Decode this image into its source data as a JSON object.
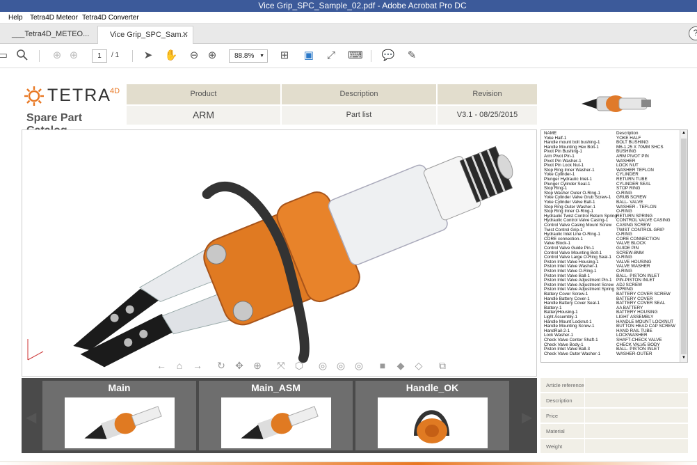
{
  "window": {
    "title": "Vice Grip_SPC_Sample_02.pdf - Adobe Acrobat Pro DC"
  },
  "menu": [
    "Help",
    "Tetra4D Meteor",
    "Tetra4D Converter"
  ],
  "tabs": [
    {
      "label": "___Tetra4D_METEO..."
    },
    {
      "label": "Vice Grip_SPC_Sam..."
    }
  ],
  "toolbar": {
    "page": "1",
    "page_total": "/ 1",
    "zoom": "88.8%"
  },
  "logo": {
    "text": "TETRA",
    "sup": "4D",
    "subtitle": "Spare Part Catalog"
  },
  "header_table": {
    "headers": [
      "Product",
      "Description",
      "Revision"
    ],
    "values": [
      "ARM",
      "Part list",
      "V3.1 - 08/25/2015"
    ]
  },
  "parts": {
    "header": {
      "name": "NAME",
      "desc": "Description"
    },
    "rows": [
      [
        "Yoke Half-1",
        "YOKE HALF"
      ],
      [
        "Handle mount bolt bushing-1",
        "BOLT BUSHING"
      ],
      [
        "Handle Mounting Hex Bolt-1",
        "M6-1.25 X 70MM SHCS"
      ],
      [
        "Pivot Pin Bushing-1",
        "BUSHING"
      ],
      [
        "Arm Pivot Pin-1",
        "ARM PIVOT PIN"
      ],
      [
        "Pivot Pin Washer-1",
        "WASHER"
      ],
      [
        "Pivot Pin Lock Nut-1",
        "LOCK NUT"
      ],
      [
        "Stop Ring Inner Washer-1",
        "WASHER TEFLON"
      ],
      [
        "Yoke Cylinder-1",
        "CYLINDER"
      ],
      [
        "Plunger Hydraulic Inlet-1",
        "RETURN TUBE"
      ],
      [
        "Plunger Cylinder Seal-1",
        "CYLINDER SEAL"
      ],
      [
        "Stop Ring-1",
        "STOP RING"
      ],
      [
        "Stop Washer Outer O-Ring-1",
        "O-RING"
      ],
      [
        "Yoke Cylinder Valve Grub Screw-1",
        "GRUB SCREW"
      ],
      [
        "Yoke Cylinder Valve Ball-1",
        "BALL- VALVE"
      ],
      [
        "Stop Ring Outer Washer-1",
        "WASHER - TEFLON"
      ],
      [
        "Stop Ring Inner O-Ring-1",
        "O-RING"
      ],
      [
        "Hydraulic Twist Control Return Spring",
        "RETURN SPRING"
      ],
      [
        "Hydraulic Control Valve Casing-1",
        "CONTROL VALVE CASING"
      ],
      [
        "Control Valve Casing Mount Screw",
        "CASING SCREW"
      ],
      [
        "Twist Control Grip-1",
        "TWIST CONTROL GRIP"
      ],
      [
        "Hydraulic Inlet Line O-Ring-1",
        "O-RING"
      ],
      [
        "CORE connection-1",
        "CORE CONNECTION"
      ],
      [
        "Valve Block-1",
        "VALVE BLOCK"
      ],
      [
        "Control Valve Guide Pin-1",
        "GUIDE PIN"
      ],
      [
        "Control Valve Mounting Bolt-1",
        "SCREW-8MM"
      ],
      [
        "Control Valve Large O-Ring Seal-1",
        "O-RING"
      ],
      [
        "Piston Inlet Valve Housing-1",
        "VALVE HOUSING"
      ],
      [
        "Piston Inlet Valve Washer-1",
        "VALVE WASHER"
      ],
      [
        "Piston Inlet Valve O-Ring-1",
        "O-RING"
      ],
      [
        "Piston Inlet Valve Ball-1",
        "BALL- PISTON INLET"
      ],
      [
        "Piston Inlet Valve Adjustment Pin-1",
        "PIN-PISTON INLET"
      ],
      [
        "Piston Inlet Valve Adjustment Screw",
        "ADJ SCREW"
      ],
      [
        "Piston Inlet Valve Adjustment Spring",
        "SPRING"
      ],
      [
        "Battery Cover Screw-1",
        "BATTERY COVER SCREW"
      ],
      [
        "Handle Battery Cover-1",
        "BATTERY COVER"
      ],
      [
        "Handle Battery Cover Seal-1",
        "BATTERY COVER SEAL"
      ],
      [
        "Battery-1",
        "AA BATTERY"
      ],
      [
        "BatteryHousing-1",
        "BATTERY HOUSING"
      ],
      [
        "Light Assembly-1",
        "LIGHT ASSEMBLY"
      ],
      [
        "Handle Mount Locknut-1",
        "HANDLE MOUNT LOCKNUT"
      ],
      [
        "Handle Mounting Screw-1",
        "BUTTON HEAD CAP SCREW"
      ],
      [
        "HandRail-2-1",
        "HAND RAIL TUBE"
      ],
      [
        "Lock Washer-1",
        "LOCKWASHER"
      ],
      [
        "Check Valve Center Shaft-1",
        "SHAFT-CHECK VALVE"
      ],
      [
        "Check Valve Body-1",
        "CHECK VALVE BODY"
      ],
      [
        "Piston Inlet Valve Ball-3",
        "BALL- PISTON INLET"
      ],
      [
        "Check Valve Outer Washer-1",
        "WASHER-OUTER"
      ]
    ]
  },
  "thumbnails": [
    {
      "label": "Main"
    },
    {
      "label": "Main_ASM"
    },
    {
      "label": "Handle_OK"
    }
  ],
  "properties": [
    "Article reference",
    "Description",
    "Price",
    "Material",
    "Weight"
  ],
  "colors": {
    "accent": "#e87722",
    "titlebar": "#3c5a9a",
    "header_bg": "#e2ddcd"
  }
}
